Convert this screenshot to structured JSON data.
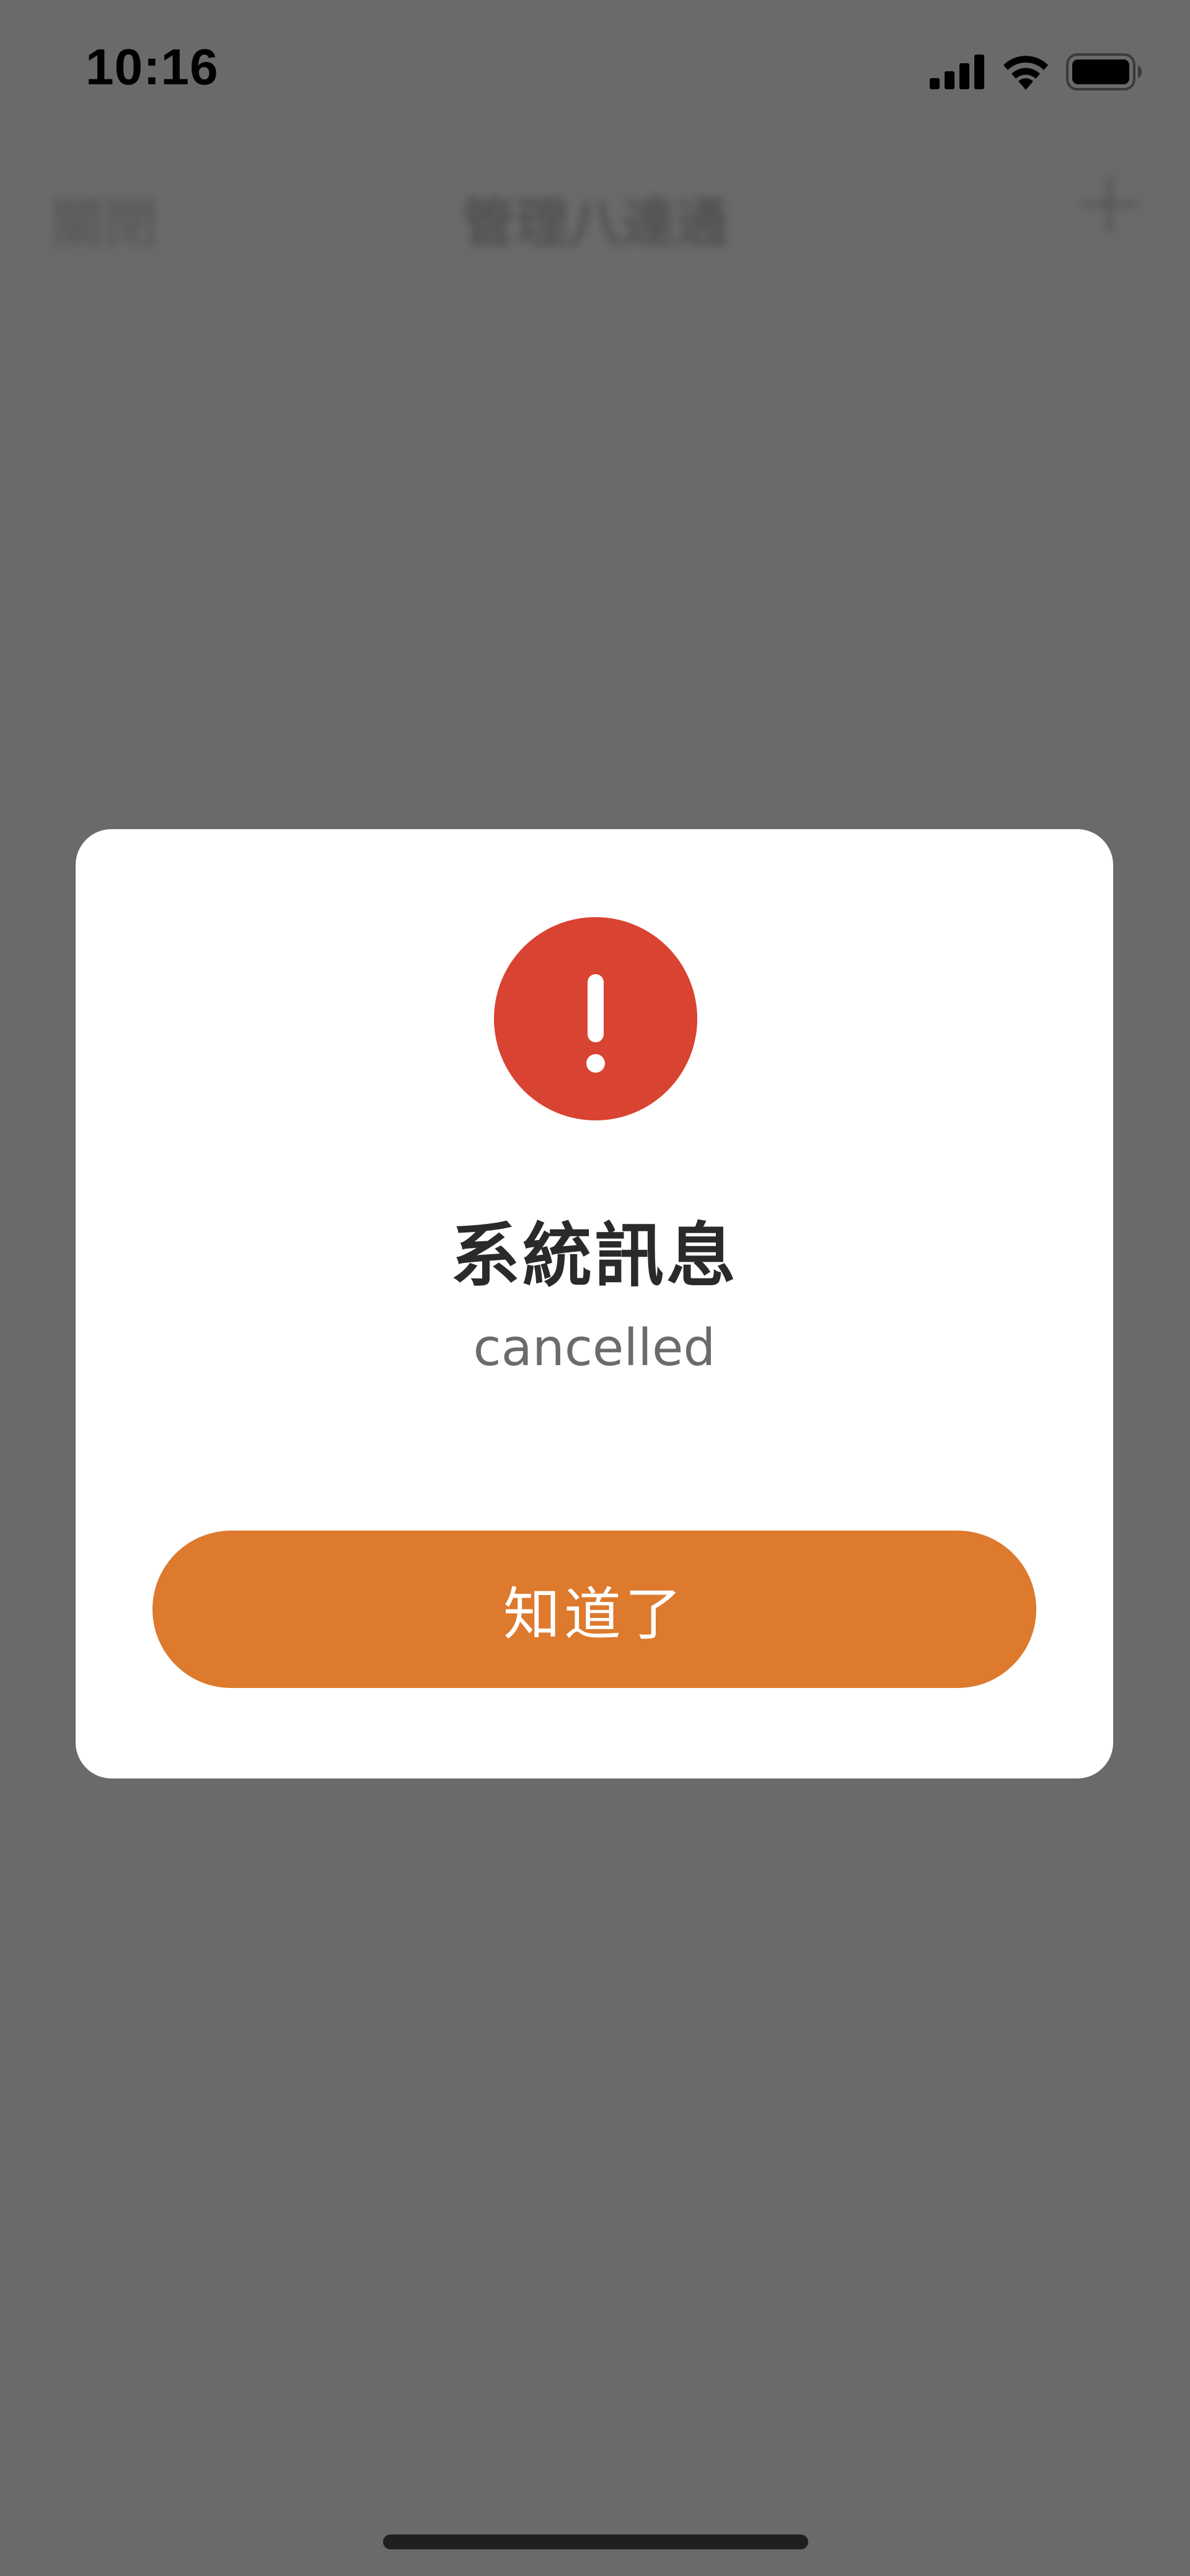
{
  "status_bar": {
    "time": "10:16",
    "icons": [
      "cellular-signal-icon",
      "wifi-icon",
      "battery-icon"
    ]
  },
  "navigation": {
    "close_label": "關閉",
    "title": "管理八達通",
    "add_icon": "plus-icon"
  },
  "dialog": {
    "icon": "exclamation-icon",
    "title": "系統訊息",
    "message": "cancelled",
    "confirm_label": "知道了"
  },
  "colors": {
    "overlay": "#6a6a6a",
    "alert_red": "#d94331",
    "button_orange": "#dd7a2e",
    "dialog_bg": "#ffffff"
  }
}
